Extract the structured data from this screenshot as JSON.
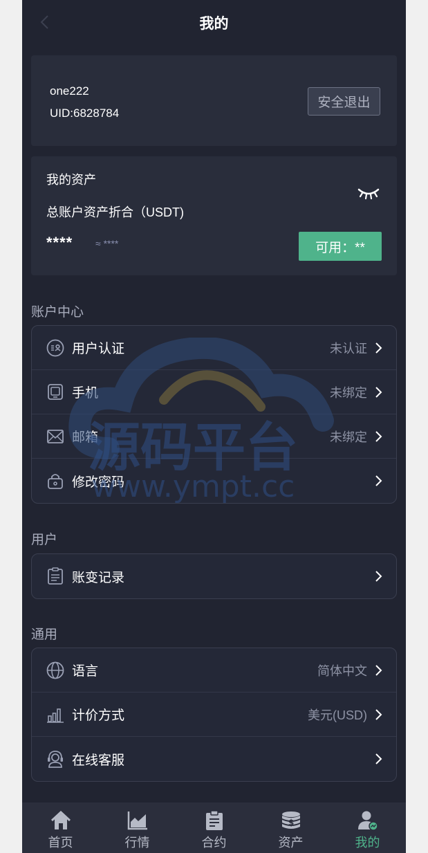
{
  "header": {
    "title": "我的"
  },
  "profile": {
    "username": "one222",
    "uid": "UID:6828784",
    "logout_label": "安全退出"
  },
  "assets": {
    "title": "我的资产",
    "subtitle": "总账户资产折合（USDT)",
    "hidden_amount": "****",
    "approx_amount": "≈ ****",
    "available_label": "可用：**"
  },
  "sections": {
    "account": {
      "label": "账户中心",
      "items": [
        {
          "label": "用户认证",
          "value": "未认证",
          "icon": "id-card-icon"
        },
        {
          "label": "手机",
          "value": "未绑定",
          "icon": "phone-icon"
        },
        {
          "label": "邮箱",
          "value": "未绑定",
          "icon": "mail-icon"
        },
        {
          "label": "修改密码",
          "value": "",
          "icon": "lock-icon"
        }
      ]
    },
    "user": {
      "label": "用户",
      "items": [
        {
          "label": "账变记录",
          "value": "",
          "icon": "clipboard-icon"
        }
      ]
    },
    "general": {
      "label": "通用",
      "items": [
        {
          "label": "语言",
          "value": "简体中文",
          "icon": "globe-icon"
        },
        {
          "label": "计价方式",
          "value": "美元(USD)",
          "icon": "bar-chart-icon"
        },
        {
          "label": "在线客服",
          "value": "",
          "icon": "headset-icon"
        }
      ]
    }
  },
  "watermark": {
    "brand": "源码平台",
    "url": "www.ympt.cc"
  },
  "nav": {
    "items": [
      {
        "label": "首页",
        "icon": "home-icon"
      },
      {
        "label": "行情",
        "icon": "chart-icon"
      },
      {
        "label": "合约",
        "icon": "contract-icon"
      },
      {
        "label": "资产",
        "icon": "coins-icon"
      },
      {
        "label": "我的",
        "icon": "user-icon"
      }
    ],
    "active_index": 4
  },
  "colors": {
    "background": "#212431",
    "card": "#292d3b",
    "accent": "#4fb38b",
    "muted_text": "#8e93a5"
  }
}
